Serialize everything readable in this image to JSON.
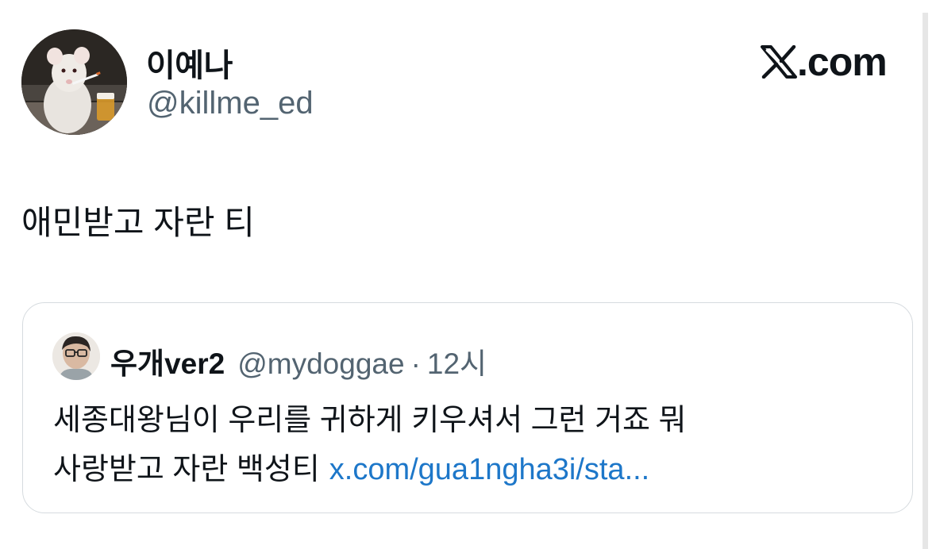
{
  "tweet": {
    "author": {
      "display_name": "이예나",
      "handle": "@killme_ed",
      "avatar_icon": "avatar-rat-photo"
    },
    "brand": {
      "logo_icon": "x-logo-icon",
      "text": ".com"
    },
    "text": "애민받고 자란 티",
    "quote": {
      "author": {
        "display_name": "우개ver2",
        "handle": "@mydoggae",
        "separator": "·",
        "time": "12시",
        "avatar_icon": "avatar-person-photo"
      },
      "line1": "세종대왕님이 우리를 귀하게 키우셔서 그런 거죠 뭐",
      "line2_text": "사랑받고 자란 백성티",
      "link": "x.com/gua1ngha3i/sta..."
    }
  },
  "colors": {
    "text_primary": "#0f1419",
    "text_secondary": "#536471",
    "link": "#1d77c9",
    "card_border": "#d6dbdf"
  }
}
